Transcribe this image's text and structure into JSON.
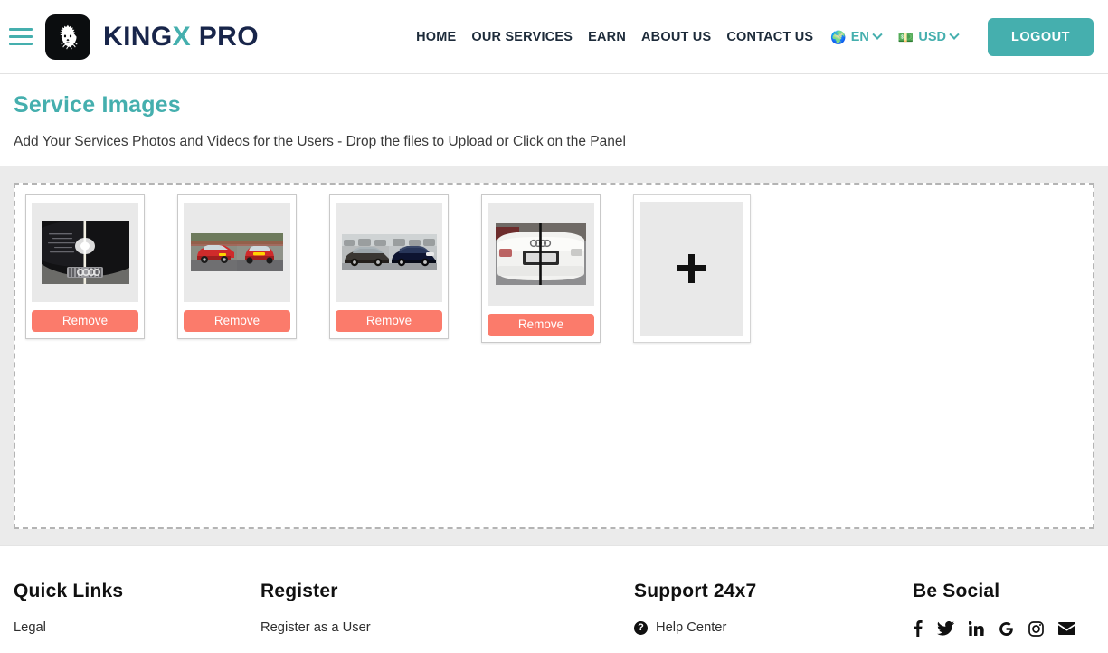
{
  "header": {
    "menu_icon": "hamburger-icon",
    "logo_icon": "lion-head-logo",
    "brand_part1": "KING",
    "brand_accent": "X",
    "brand_part2": " PRO",
    "nav": [
      {
        "label": "HOME"
      },
      {
        "label": "OUR SERVICES"
      },
      {
        "label": "EARN"
      },
      {
        "label": "ABOUT US"
      },
      {
        "label": "CONTACT US"
      }
    ],
    "language": {
      "icon": "globe-icon",
      "emoji": "🌍",
      "label": "EN"
    },
    "currency": {
      "icon": "money-icon",
      "emoji": "💵",
      "label": "USD"
    },
    "logout_label": "LOGOUT",
    "accent_color": "#45afae",
    "brand_color": "#18254a"
  },
  "page": {
    "title": "Service Images",
    "subtitle": "Add Your Services Photos and Videos for the Users - Drop the files to Upload or Click on the Panel"
  },
  "uploader": {
    "remove_label": "Remove",
    "add_label": "+",
    "remove_color": "#fb7b6b",
    "items": [
      {
        "alt": "black-car-hood-before-after",
        "remove_label": "Remove"
      },
      {
        "alt": "red-mini-cooper-before-after",
        "remove_label": "Remove"
      },
      {
        "alt": "dark-sedan-before-after",
        "remove_label": "Remove"
      },
      {
        "alt": "white-audi-rear-before-after",
        "remove_label": "Remove"
      }
    ]
  },
  "footer": {
    "columns": [
      {
        "title": "Quick Links",
        "links": [
          {
            "label": "Legal"
          }
        ]
      },
      {
        "title": "Register",
        "links": [
          {
            "label": "Register as a User"
          }
        ]
      },
      {
        "title": "Support 24x7",
        "links": [
          {
            "label": "Help Center",
            "icon": "question-mark-icon"
          }
        ]
      },
      {
        "title": "Be Social",
        "socials": [
          {
            "name": "facebook-icon"
          },
          {
            "name": "twitter-icon"
          },
          {
            "name": "linkedin-icon"
          },
          {
            "name": "google-icon"
          },
          {
            "name": "instagram-icon"
          },
          {
            "name": "email-icon"
          }
        ]
      }
    ]
  }
}
